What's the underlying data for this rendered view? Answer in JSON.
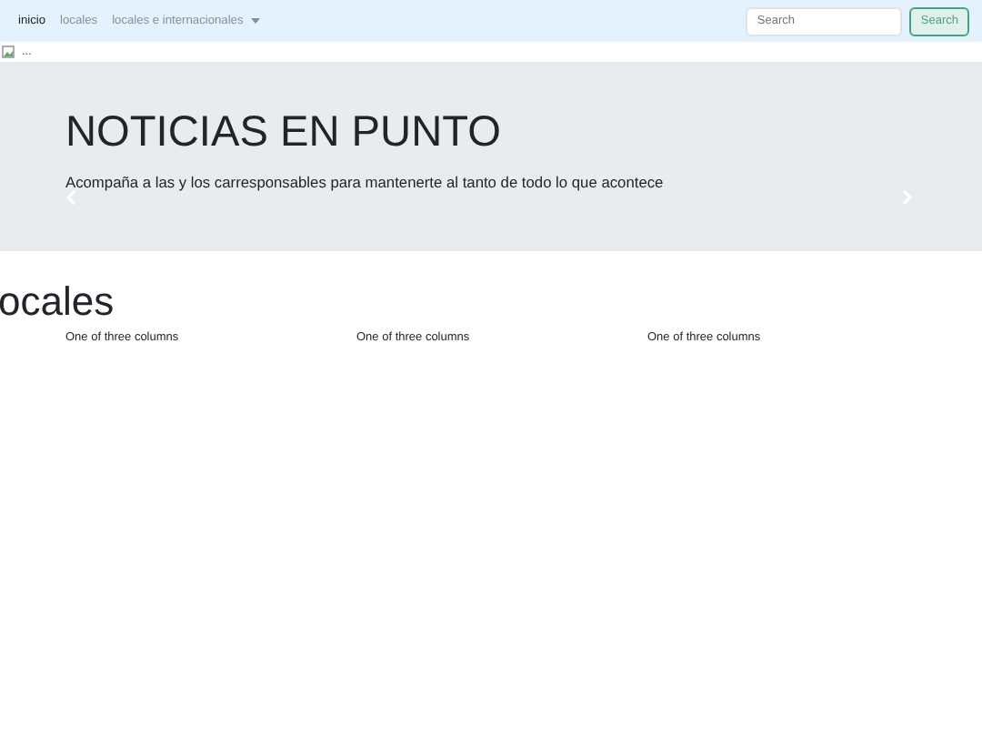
{
  "navbar": {
    "items": [
      {
        "label": "inicio",
        "selected": true,
        "kind": "link"
      },
      {
        "label": "locales",
        "selected": false,
        "kind": "link"
      },
      {
        "label": "locales e internacionales",
        "selected": false,
        "kind": "dropdown"
      }
    ],
    "search": {
      "placeholder": "Search",
      "button": "Search"
    }
  },
  "broken_image": {
    "alt": "..."
  },
  "carousel": {
    "title": "NOTICIAS EN PUNTO",
    "subtitle": "Acompaña a las y los carresponsables para mantenerte al tanto de todo lo que acontece"
  },
  "section": {
    "heading": "ocales",
    "columns": [
      "One of three columns",
      "One of three columns",
      "One of three columns"
    ]
  }
}
